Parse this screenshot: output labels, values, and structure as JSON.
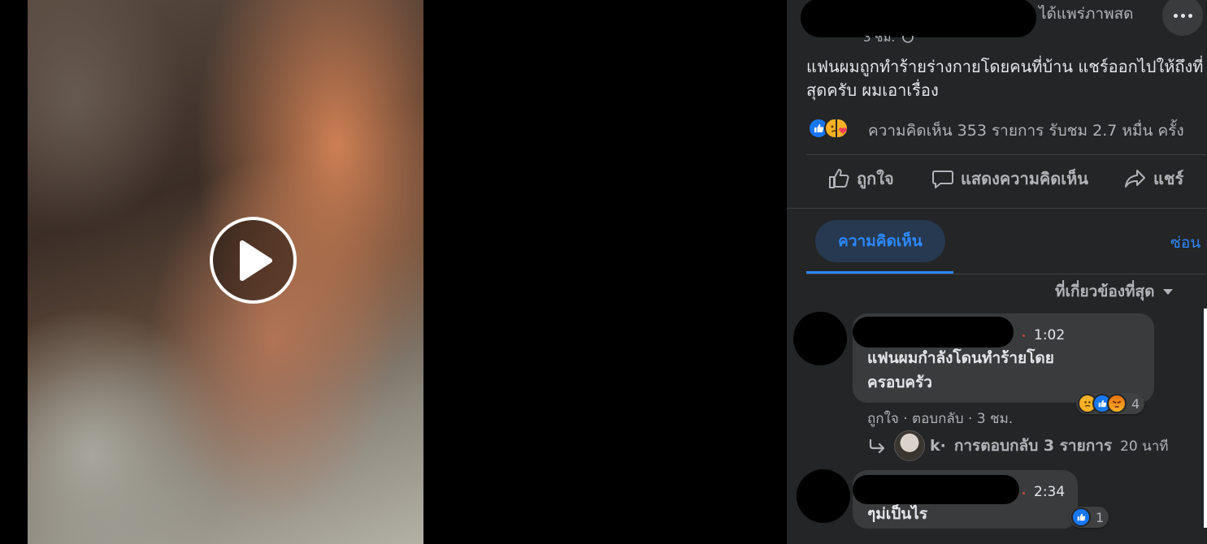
{
  "video": {
    "play_label": "Play"
  },
  "post": {
    "status": "ได้แพร่ภาพสด",
    "meta_partial": "3 ชม.",
    "caption": "แฟนผมถูกทำร้ายร่างกายโดยคนที่บ้าน แชร์ออกไปให้ถึงที่สุดครับ ผมเอาเรื่อง",
    "stats": "ความคิดเห็น 353 รายการ รับชม 2.7 หมื่น ครั้ง",
    "reaction_icons": [
      "like-icon",
      "sad-icon",
      "care-icon"
    ]
  },
  "actions": {
    "like": "ถูกใจ",
    "comment": "แสดงความคิดเห็น",
    "share": "แชร์"
  },
  "tabs": {
    "comments": "ความคิดเห็น",
    "hide": "ซ่อน"
  },
  "sort": {
    "label": "ที่เกี่ยวข้องที่สุด"
  },
  "comments": [
    {
      "time": "1:02",
      "text": "แฟนผมกำลังโดนทำร้ายโดยครอบครัว",
      "reaction_count": "4",
      "reactions": [
        "sad-icon",
        "like-icon",
        "angry-icon"
      ],
      "actions": "ถูกใจ · ตอบกลับ · 3 ชม.",
      "reply_name_partial": "k·",
      "reply_summary": "การตอบกลับ 3 รายการ",
      "reply_time": "20 นาที"
    },
    {
      "time": "2:34",
      "text": "ๆม่เป็นไร",
      "reaction_count": "1",
      "reactions": [
        "like-icon"
      ]
    }
  ],
  "colors": {
    "panel": "#242526",
    "bubble": "#3a3b3c",
    "accent": "#2d88ff",
    "text": "#e4e6eb",
    "muted": "#b0b3b8"
  }
}
